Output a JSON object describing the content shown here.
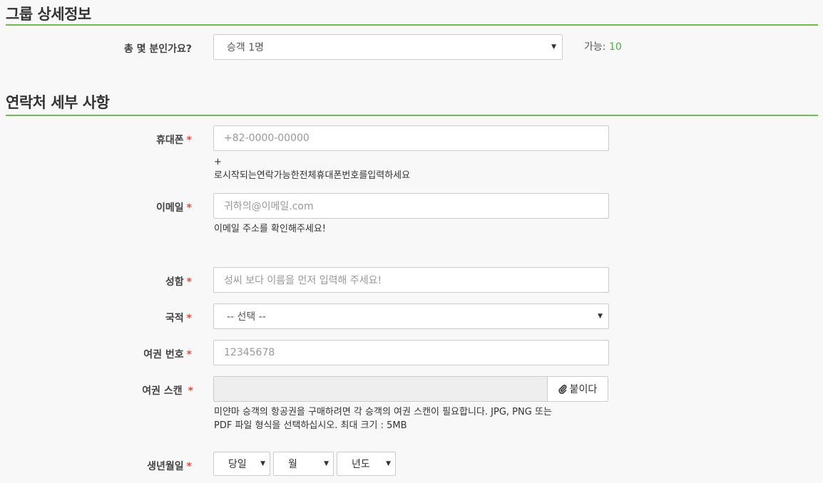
{
  "group_section": {
    "title": "그룹 상세정보",
    "total_label": "총 몇 분인가요?",
    "total_value": "승객 1명",
    "available_label": "가능:",
    "available_value": "10"
  },
  "contact_section": {
    "title": "연락처 세부 사항",
    "required_mark": "*",
    "phone": {
      "label": "휴대폰",
      "placeholder": "+82-0000-00000",
      "help_line1": "+",
      "help_line2": "로시작되는연락가능한전체휴대폰번호를입력하세요"
    },
    "email": {
      "label": "이메일",
      "placeholder": "귀하의@이메일.com",
      "help": "이메일 주소를 확인해주세요!"
    },
    "name": {
      "label": "성함",
      "placeholder": "성씨 보다 이름을 먼저 입력해 주세요!"
    },
    "nationality": {
      "label": "국적",
      "value": "-- 선택 --"
    },
    "passport_no": {
      "label": "여권 번호",
      "placeholder": "12345678"
    },
    "passport_scan": {
      "label": "여권 스캔",
      "attach_label": "붙이다",
      "help_line1": "미얀마 승객의 항공권을 구매하려면 각 승객의 여권 스캔이 필요합니다. JPG, PNG 또는",
      "help_line2": "PDF 파일 형식을 선택하십시오. 최대 크기 : 5MB"
    },
    "birthdate": {
      "label": "생년월일",
      "day": "당일",
      "month": "월",
      "year": "년도"
    }
  },
  "icons": {
    "dropdown": "caret-down-icon",
    "attach": "paperclip-icon"
  },
  "colors": {
    "accent": "#6cc04a",
    "required": "#e74c3c",
    "available_number": "#4caf50"
  }
}
